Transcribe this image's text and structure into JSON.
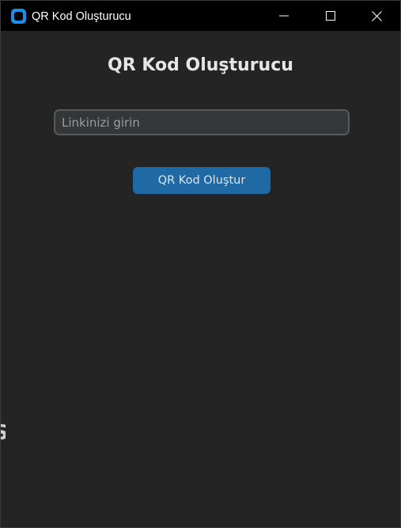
{
  "window": {
    "title": "QR Kod Oluşturucu",
    "controls": {
      "minimize": "minimize-icon",
      "maximize": "maximize-icon",
      "close": "close-icon"
    },
    "app_icon": "app-icon"
  },
  "main": {
    "heading": "QR Kod Oluşturucu",
    "link_input": {
      "value": "",
      "placeholder": "Linkinizi girin"
    },
    "generate_button_label": "QR Kod Oluştur",
    "edge_fragment": "S"
  },
  "colors": {
    "titlebar": "#000000",
    "background": "#242424",
    "accent": "#1f6aa5",
    "input_bg": "#343638",
    "input_border": "#565b5e",
    "app_icon": "#1e8fe8"
  }
}
